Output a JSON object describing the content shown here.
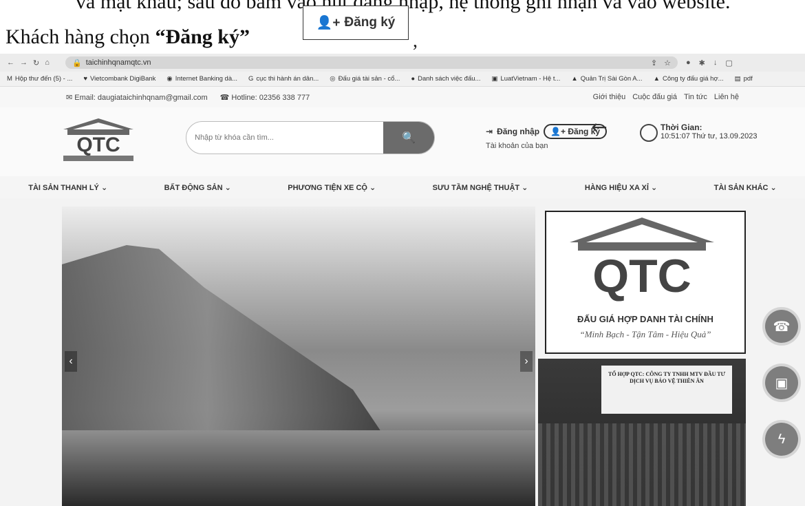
{
  "document": {
    "top_text": "và mật khẩu; sau đó bấm vào nút đăng nhập, hệ thống ghi nhận và vào website.",
    "caption": "Khách hàng chọn",
    "caption_quote": "“Đăng ký”",
    "callout_button": "Đăng ký",
    "comma": ","
  },
  "browser": {
    "url": "taichinhqnamqtc.vn",
    "bookmarks": [
      "Hộp thư đến (5) - ...",
      "Vietcombank DigiBank",
      "Internet Banking dà...",
      "cục thi hành án dân...",
      "Đấu giá tài sản - cổ...",
      "Danh sách việc đấu...",
      "LuatVietnam - Hệ t...",
      "Quản Trị Sài Gòn A...",
      "Công ty đấu giá hợ...",
      "pdf"
    ]
  },
  "site": {
    "contact_email": "Email: daugiataichinhqnam@gmail.com",
    "contact_hotline": "Hotline: 02356 338 777",
    "top_links": [
      "Giới thiệu",
      "Cuộc đấu giá",
      "Tin tức",
      "Liên hệ"
    ],
    "search_placeholder": "Nhập từ khóa cần tìm...",
    "login_label": "Đăng nhập",
    "register_label": "Đăng ký",
    "account_label": "Tài khoản của bạn",
    "time_title": "Thời Gian:",
    "time_value": "10:51:07 Thứ tư, 13.09.2023",
    "menu": [
      "TÀI SẢN THANH LÝ ⌄",
      "BẤT ĐỘNG SẢN ⌄",
      "PHƯƠNG TIỆN XE CỘ ⌄",
      "SƯU TẦM NGHỆ THUẬT ⌄",
      "HÀNG HIỆU XA XỈ ⌄",
      "TÀI SẢN KHÁC ⌄"
    ],
    "ad_title": "ĐẤU GIÁ HỢP DANH TÀI CHÍNH",
    "ad_slogan": "“Minh Bạch - Tận Tâm - Hiệu Quả”",
    "ad2_banner": "TỔ HỢP QTC: CÔNG TY TNHH MTV ĐẦU TƯ DỊCH VỤ BẢO VỆ THIÊN ÂN"
  }
}
